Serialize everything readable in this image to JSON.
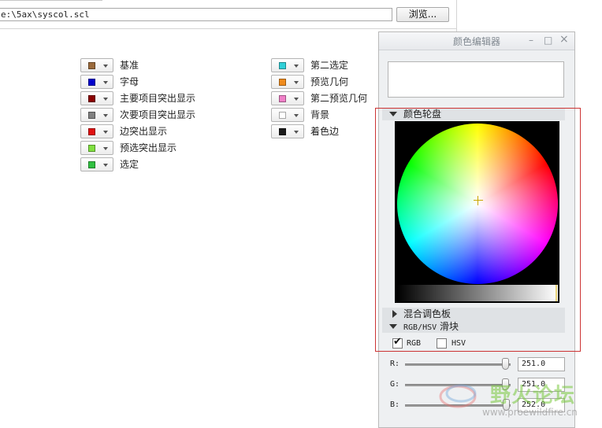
{
  "path_bar": {
    "path_value": "e:\\5ax\\syscol.scl",
    "browse_label": "浏览..."
  },
  "colors_left": [
    {
      "label": "基准",
      "color": "#9a6a3c"
    },
    {
      "label": "字母",
      "color": "#0000cc"
    },
    {
      "label": "主要项目突出显示",
      "color": "#8b0000"
    },
    {
      "label": "次要项目突出显示",
      "color": "#808080"
    },
    {
      "label": "边突出显示",
      "color": "#e01010"
    },
    {
      "label": "预选突出显示",
      "color": "#80e040"
    },
    {
      "label": "选定",
      "color": "#30c040"
    }
  ],
  "colors_right": [
    {
      "label": "第二选定",
      "color": "#30d0d8"
    },
    {
      "label": "预览几何",
      "color": "#f08c1e"
    },
    {
      "label": "第二预览几何",
      "color": "#f080c8"
    },
    {
      "label": "背景",
      "color": "#ffffff"
    },
    {
      "label": "着色边",
      "color": "#1a1a1a"
    }
  ],
  "editor": {
    "title": "颜色编辑器",
    "minimize_glyph": "–",
    "maximize_glyph": "□",
    "close_glyph": "×",
    "wheel_section": "颜色轮盘",
    "palette_section": "混合调色板",
    "slider_section_prefix": "RGB/HSV",
    "slider_section_suffix": "滑块",
    "rgb_check_label": "RGB",
    "hsv_check_label": "HSV",
    "rgb_checked": true,
    "hsv_checked": false,
    "sliders": [
      {
        "label": "R:",
        "value": "251.0",
        "fraction": 0.98
      },
      {
        "label": "G:",
        "value": "251.0",
        "fraction": 0.98
      },
      {
        "label": "B:",
        "value": "252.0",
        "fraction": 0.99
      }
    ]
  },
  "watermark": {
    "site_name": "野火论坛",
    "url": "www.proewildfire.cn"
  }
}
